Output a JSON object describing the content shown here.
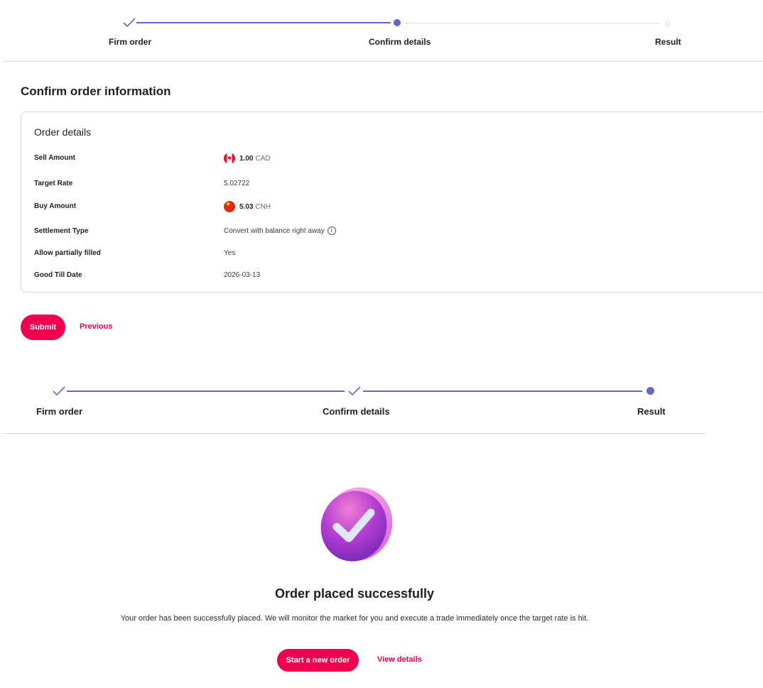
{
  "stepper1": {
    "steps": [
      {
        "label": "Firm order",
        "state": "done"
      },
      {
        "label": "Confirm details",
        "state": "active"
      },
      {
        "label": "Result",
        "state": "pending"
      }
    ]
  },
  "confirm": {
    "title": "Confirm order information",
    "card_title": "Order details",
    "rows": [
      {
        "label": "Sell Amount",
        "value": "1.00",
        "currency": "CAD",
        "flag": "canada-flag-icon"
      },
      {
        "label": "Target Rate",
        "value": "5.02722"
      },
      {
        "label": "Buy Amount",
        "value": "5.03",
        "currency": "CNH",
        "flag": "china-flag-icon"
      },
      {
        "label": "Settlement Type",
        "value": "Convert with balance right away",
        "icon": "info-icon"
      },
      {
        "label": "Allow partially filled",
        "value": "Yes"
      },
      {
        "label": "Good Till Date",
        "value": "2026-03-13"
      }
    ],
    "submit_label": "Submit",
    "previous_label": "Previous"
  },
  "stepper2": {
    "steps": [
      {
        "label": "Firm order",
        "state": "done"
      },
      {
        "label": "Confirm details",
        "state": "done"
      },
      {
        "label": "Result",
        "state": "active"
      }
    ]
  },
  "result": {
    "icon": "success-check-icon",
    "title": "Order placed successfully",
    "description": "Your order has been successfully placed. We will monitor the market for you and execute a trade immediately once the target rate is hit.",
    "new_order_label": "Start a new order",
    "view_details_label": "View details"
  },
  "colors": {
    "accent": "#f0004f",
    "step_active": "#6466c4",
    "step_inactive": "#d9d9d9"
  }
}
